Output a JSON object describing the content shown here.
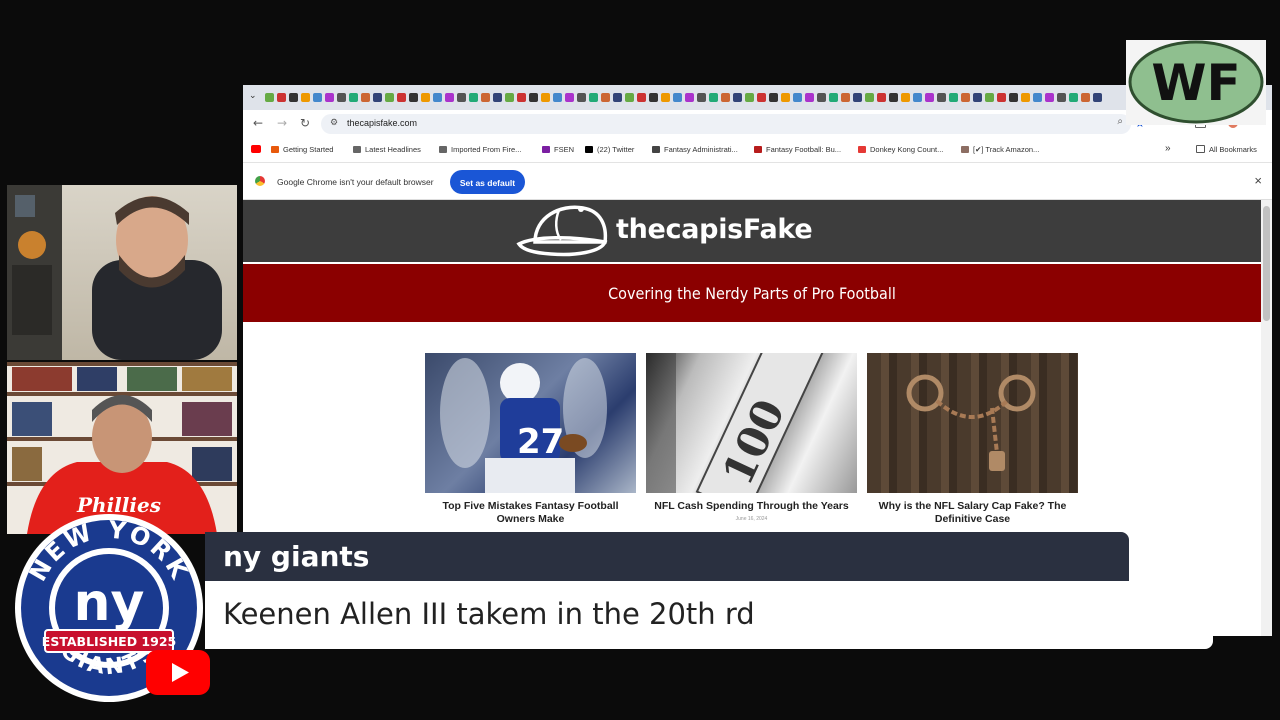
{
  "browser": {
    "url": "thecapisfake.com",
    "bookmarks": [
      {
        "label": "Getting Started",
        "color": "#e8590c"
      },
      {
        "label": "Latest Headlines",
        "color": "#666666"
      },
      {
        "label": "Imported From Fire...",
        "color": "#666666"
      },
      {
        "label": "FSEN",
        "color": "#7b1fa2"
      },
      {
        "label": "(22) Twitter",
        "color": "#000000"
      },
      {
        "label": "Fantasy Administrati...",
        "color": "#444444"
      },
      {
        "label": "Fantasy Football: Bu...",
        "color": "#b71c1c"
      },
      {
        "label": "Donkey Kong Count...",
        "color": "#e53935"
      },
      {
        "label": "[✔] Track Amazon...",
        "color": "#8d6e63"
      }
    ],
    "all_bookmarks": "All Bookmarks",
    "infobar_text": "Google Chrome isn't your default browser",
    "set_default_label": "Set as default",
    "close_glyph": "×"
  },
  "site": {
    "brand": "thecapisFake",
    "tagline": "Covering the Nerdy Parts of Pro Football",
    "cards": [
      {
        "title": "Top Five Mistakes Fantasy Football Owners Make",
        "date": "",
        "image": "football-player-photo"
      },
      {
        "title": "NFL Cash Spending Through the Years",
        "date": "June 16, 2024",
        "image": "money-bills-photo"
      },
      {
        "title": "Why is the NFL Salary Cap Fake? The Definitive Case",
        "date": "",
        "image": "chained-door-photo"
      }
    ]
  },
  "overlay": {
    "topic": "ny giants",
    "message": "Keenen Allen III takem in the 20th rd",
    "wf_logo": "WF",
    "giants_badge": {
      "top": "NEW YORK",
      "center": "ny",
      "banner": "ESTABLISHED 1925",
      "bottom": "GIANTS"
    }
  },
  "colors": {
    "site_header": "#3d3d3d",
    "tagline_band": "#8b0000",
    "topic_bar": "#2a3040",
    "giants_blue": "#1a3a8f",
    "giants_red": "#c8102e",
    "chrome_blue": "#1a56d6"
  }
}
